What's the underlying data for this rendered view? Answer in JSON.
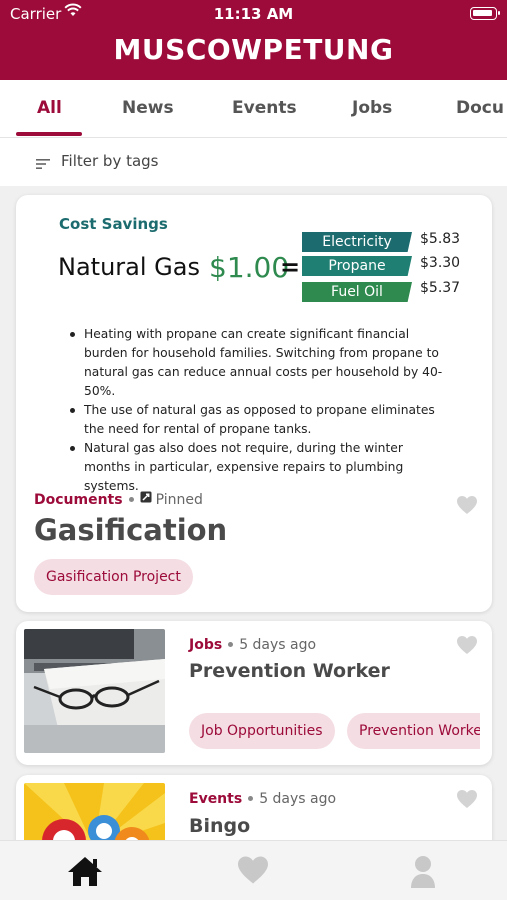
{
  "status_bar": {
    "carrier": "Carrier",
    "time": "11:13 AM"
  },
  "app": {
    "title": "MUSCOWPETUNG",
    "brand_color": "#9c0b3a"
  },
  "tabs": [
    {
      "label": "All",
      "active": true
    },
    {
      "label": "News"
    },
    {
      "label": "Events"
    },
    {
      "label": "Jobs"
    },
    {
      "label": "Docu"
    }
  ],
  "filter": {
    "label": "Filter by tags"
  },
  "feed": [
    {
      "infographic": {
        "heading": "Cost Savings",
        "compare_label": "Natural Gas",
        "price": "$1.00",
        "equals": "=",
        "rows": [
          {
            "label": "Electricity",
            "value": "$5.83",
            "color": "#1c6b6e"
          },
          {
            "label": "Propane",
            "value": "$3.30",
            "color": "#1f7f73"
          },
          {
            "label": "Fuel Oil",
            "value": "$5.37",
            "color": "#2e8a4e"
          }
        ],
        "bullets": [
          "Heating with propane can create significant financial burden for household families. Switching from propane to natural gas can reduce annual costs per household by 40-50%.",
          "The use of natural gas as opposed to propane eliminates the need for rental of propane tanks.",
          "Natural gas also does not require, during the winter months in particular, expensive repairs to plumbing systems."
        ]
      },
      "category": "Documents",
      "status": "Pinned",
      "title": "Gasification",
      "tags": [
        "Gasification Project"
      ]
    },
    {
      "category": "Jobs",
      "time": "5 days ago",
      "title": "Prevention Worker",
      "tags": [
        "Job Opportunities",
        "Prevention Worker"
      ]
    },
    {
      "category": "Events",
      "time": "5 days ago",
      "title": "Bingo"
    }
  ],
  "bottom_nav": [
    "home-icon",
    "heart-icon",
    "user-icon"
  ]
}
